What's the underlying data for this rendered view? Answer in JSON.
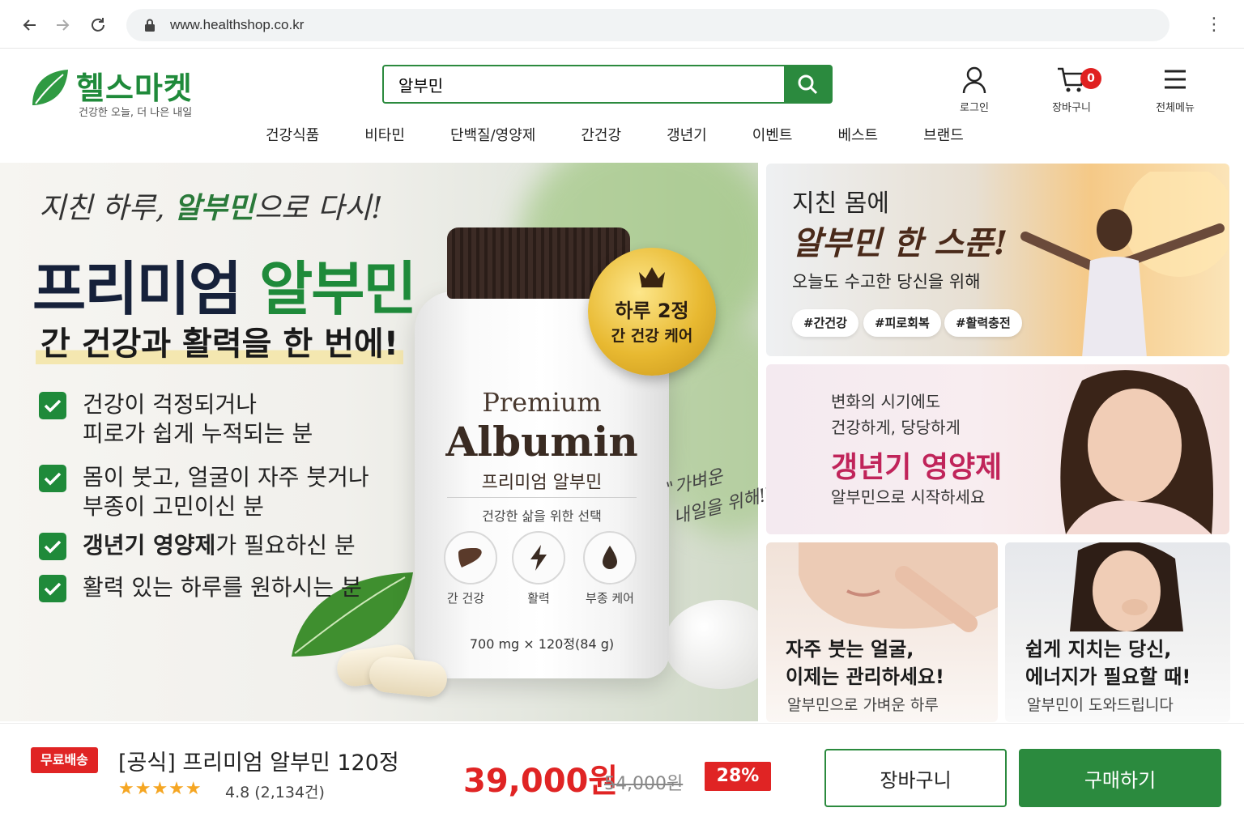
{
  "browser": {
    "url": "www.healthshop.co.kr",
    "back_icon": "arrow-left-icon",
    "forward_icon": "arrow-right-icon",
    "reload_icon": "reload-icon",
    "menu_icon": "kebab-menu-icon"
  },
  "header": {
    "logo": "헬스마켓",
    "tagline": "건강한 오늘, 더 나은 내일",
    "search_value": "알부민",
    "search_icon": "search-icon",
    "actions": [
      {
        "label": "로그인",
        "icon": "user-icon"
      },
      {
        "label": "장바구니",
        "icon": "cart-icon",
        "badge": "0"
      },
      {
        "label": "전체메뉴",
        "icon": "hamburger-icon"
      }
    ],
    "nav": [
      "건강식품",
      "비타민",
      "단백질/영양제",
      "간건강",
      "갱년기",
      "이벤트",
      "베스트",
      "브랜드"
    ]
  },
  "hero": {
    "script_pre": "지친 하루, ",
    "script_em": "알부민",
    "script_post": "으로 다시!",
    "title_dark": "프리미엄 ",
    "title_green": "알부민",
    "subtitle": "간 건강과 활력을 한 번에!",
    "checklist": [
      {
        "lines": [
          "건강이 걱정되거나",
          "피로가 쉽게 누적되는 분"
        ]
      },
      {
        "lines": [
          "몸이 붓고, 얼굴이 자주 붓거나",
          "부종이 고민이신 분"
        ]
      },
      {
        "bold": "갱년기 영양제",
        "rest": "가 필요하신 분"
      },
      {
        "lines": [
          "활력 있는 하루를 원하시는 분"
        ]
      }
    ],
    "bottle": {
      "premium": "Premium",
      "albumin": "Albumin",
      "korean": "프리미엄 알부민",
      "sub": "건강한 삶을 위한 선택",
      "icons": [
        {
          "label": "간 건강",
          "icon": "liver-icon"
        },
        {
          "label": "활력",
          "icon": "lightning-icon"
        },
        {
          "label": "부종 케어",
          "icon": "water-drop-icon"
        }
      ],
      "spec": "700 mg × 120정(84 g)"
    },
    "badge": {
      "line1": "하루 2정",
      "line2": "간 건강 케어",
      "icon": "crown-icon"
    },
    "quote_l1": "\"가벼운",
    "quote_l2": "내일을 위해!\""
  },
  "banners": {
    "b1": {
      "line1": "지친 몸에",
      "line2": "알부민 한 스푼!",
      "line3": "오늘도 수고한 당신을 위해",
      "tags": [
        "#간건강",
        "#피로회복",
        "#활력충전"
      ]
    },
    "b2": {
      "line1": "변화의 시기에도",
      "line2": "건강하게, 당당하게",
      "line3": "갱년기 영양제",
      "line4": "알부민으로 시작하세요"
    },
    "b3": {
      "title1": "자주 붓는 얼굴,",
      "title2": "이제는 관리하세요!",
      "sub": "알부민으로 가벼운 하루"
    },
    "b4": {
      "title1": "쉽게 지치는 당신,",
      "title2": "에너지가 필요할 때!",
      "sub": "알부민이 도와드립니다"
    }
  },
  "product": {
    "free_shipping": "무료배송",
    "name": "[공식] 프리미엄 알부민 120정",
    "stars": "★★★★★",
    "rating": "4.8 (2,134건)",
    "price": "39,000원",
    "original_price": "54,000원",
    "discount": "28%",
    "cart_button": "장바구니",
    "buy_button": "구매하기"
  },
  "colors": {
    "brand_green": "#2b8a3e",
    "sale_red": "#e02424"
  }
}
